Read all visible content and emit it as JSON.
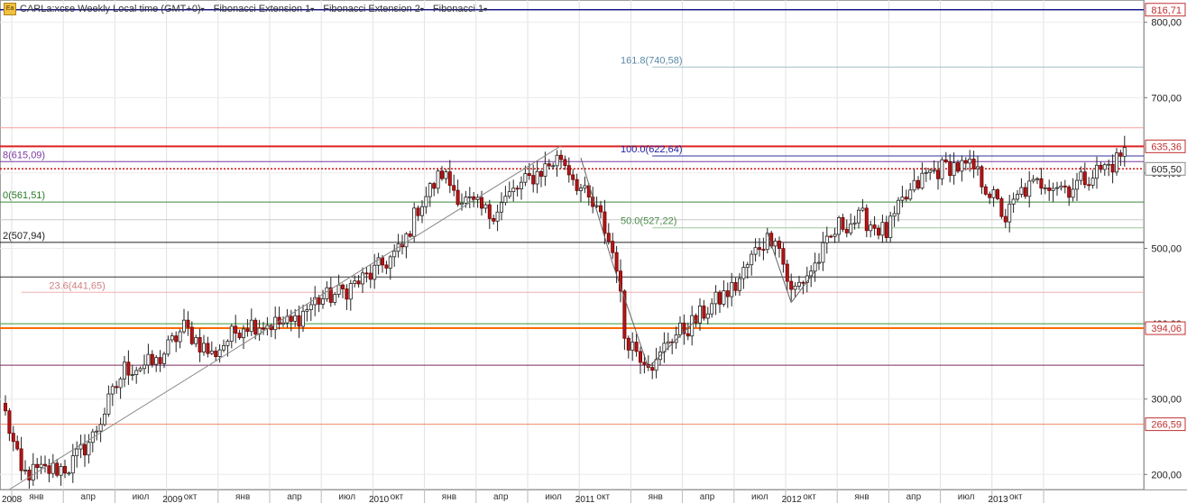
{
  "toolbar": {
    "logo_text": "Ea",
    "items": [
      {
        "label": "CARLa:xcse Weekly Local time (GMT+0)"
      },
      {
        "label": "Fibonacci Extension 1"
      },
      {
        "label": "Fibonacci Extension 2"
      },
      {
        "label": "Fibonacci 1"
      }
    ],
    "caret": "▾"
  },
  "chart_data": {
    "type": "candlestick",
    "ylim": [
      180,
      820
    ],
    "y_ticks": [
      {
        "label": "800,00",
        "value": 800
      },
      {
        "label": "700,00",
        "value": 700
      },
      {
        "label": "600,00",
        "value": 600
      },
      {
        "label": "500,00",
        "value": 500
      },
      {
        "label": "400,00",
        "value": 400
      },
      {
        "label": "300,00",
        "value": 300
      },
      {
        "label": "200,00",
        "value": 200
      }
    ],
    "month_ticks": [
      {
        "label": "окт",
        "bar": 0
      },
      {
        "label": "янв",
        "bar": 13
      },
      {
        "label": "апр",
        "bar": 26
      },
      {
        "label": "июл",
        "bar": 39
      },
      {
        "label": "окт",
        "bar": 52
      },
      {
        "label": "янв",
        "bar": 65
      },
      {
        "label": "апр",
        "bar": 78
      },
      {
        "label": "июл",
        "bar": 91
      },
      {
        "label": "окт",
        "bar": 104
      },
      {
        "label": "янв",
        "bar": 117
      },
      {
        "label": "апр",
        "bar": 130
      },
      {
        "label": "июл",
        "bar": 143
      },
      {
        "label": "окт",
        "bar": 156
      },
      {
        "label": "янв",
        "bar": 169
      },
      {
        "label": "апр",
        "bar": 182
      },
      {
        "label": "июл",
        "bar": 195
      },
      {
        "label": "окт",
        "bar": 208
      },
      {
        "label": "янв",
        "bar": 221
      },
      {
        "label": "апр",
        "bar": 234
      },
      {
        "label": "июл",
        "bar": 247
      },
      {
        "label": "окт",
        "bar": 260
      }
    ],
    "year_ticks": [
      {
        "label": "2008",
        "bar": 0
      },
      {
        "label": "2009",
        "bar": 13
      },
      {
        "label": "2010",
        "bar": 65
      },
      {
        "label": "2011",
        "bar": 117
      },
      {
        "label": "2012",
        "bar": 169
      },
      {
        "label": "2013",
        "bar": 221
      }
    ],
    "price_labels": [
      {
        "label": "816,71",
        "value": 816.71,
        "color": "#c03030",
        "line": "#1a1a8c",
        "width": 1.5
      },
      {
        "label": "635,36",
        "value": 635.36,
        "color": "#c03030",
        "line": "#dd2222",
        "width": 2
      },
      {
        "label": "605,50",
        "value": 605.5,
        "color": "#222222",
        "line": "#cc1111",
        "width": 1.5,
        "dash": true
      },
      {
        "label": "394,06",
        "value": 394.06,
        "color": "#c03030",
        "line": "#ff6a00",
        "width": 2
      },
      {
        "label": "266,59",
        "value": 266.59,
        "color": "#c03030",
        "line": "#ee8866",
        "width": 1
      }
    ],
    "h_lines": [
      {
        "value": 740.58,
        "color": "#a0c0c8",
        "from_bar": 163
      },
      {
        "value": 660,
        "color": "#f2a0a0"
      },
      {
        "value": 622.64,
        "color": "#3030a0",
        "from_bar": 163
      },
      {
        "value": 615.09,
        "color": "#7a3aa0"
      },
      {
        "value": 561.51,
        "color": "#3a8a3a"
      },
      {
        "value": 538,
        "color": "#c8c8c8"
      },
      {
        "value": 527.22,
        "color": "#9ac89a",
        "from_bar": 163
      },
      {
        "value": 507.94,
        "color": "#222222"
      },
      {
        "value": 462,
        "color": "#333333"
      },
      {
        "value": 441.65,
        "color": "#f0b0b0",
        "from_bar": 4
      },
      {
        "value": 400,
        "color": "#3a9a3a"
      },
      {
        "value": 345,
        "color": "#7a2a5a"
      }
    ],
    "fib_labels": [
      {
        "text": "161.8(740,58)",
        "value": 740.58,
        "bar": 155,
        "color": "#5a8aa8"
      },
      {
        "text": "8(615,09)",
        "value": 615.09,
        "bar": 0,
        "color": "#7a3aa0"
      },
      {
        "text": "100.0(622,64)",
        "value": 622.64,
        "bar": 155,
        "color": "#2020a0"
      },
      {
        "text": "0(561,51)",
        "value": 561.51,
        "bar": 0,
        "color": "#2a7a2a"
      },
      {
        "text": "50.0(527,22)",
        "value": 527.22,
        "bar": 155,
        "color": "#4a8a4a"
      },
      {
        "text": "2(507,94)",
        "value": 507.94,
        "bar": 0,
        "color": "#222222"
      },
      {
        "text": "23.6(441,65)",
        "value": 441.65,
        "bar": 11,
        "color": "#d08080"
      }
    ],
    "trend_lines": [
      {
        "from": [
          1,
          180
        ],
        "to": [
          140,
          636
        ],
        "color": "#888888"
      },
      {
        "from": [
          145,
          620
        ],
        "to": [
          153,
          480
        ],
        "color": "#666666"
      },
      {
        "from": [
          153,
          480
        ],
        "to": [
          162,
          342
        ],
        "color": "#666666"
      },
      {
        "from": [
          162,
          342
        ],
        "to": [
          174,
          405
        ],
        "color": "#666666"
      },
      {
        "from": [
          192,
          520
        ],
        "to": [
          198,
          428
        ],
        "color": "#666666"
      },
      {
        "from": [
          198,
          428
        ],
        "to": [
          204,
          470
        ],
        "color": "#666666"
      }
    ],
    "anchors": [
      [
        0,
        280
      ],
      [
        4,
        200
      ],
      [
        10,
        205
      ],
      [
        16,
        210
      ],
      [
        22,
        250
      ],
      [
        30,
        340
      ],
      [
        38,
        348
      ],
      [
        45,
        395
      ],
      [
        52,
        358
      ],
      [
        60,
        400
      ],
      [
        72,
        400
      ],
      [
        78,
        430
      ],
      [
        84,
        440
      ],
      [
        92,
        465
      ],
      [
        100,
        500
      ],
      [
        104,
        555
      ],
      [
        110,
        600
      ],
      [
        115,
        565
      ],
      [
        122,
        545
      ],
      [
        128,
        575
      ],
      [
        134,
        600
      ],
      [
        140,
        622
      ],
      [
        146,
        570
      ],
      [
        150,
        540
      ],
      [
        154,
        480
      ],
      [
        156,
        385
      ],
      [
        160,
        360
      ],
      [
        164,
        345
      ],
      [
        167,
        380
      ],
      [
        172,
        395
      ],
      [
        177,
        420
      ],
      [
        184,
        450
      ],
      [
        190,
        505
      ],
      [
        194,
        520
      ],
      [
        198,
        440
      ],
      [
        204,
        478
      ],
      [
        210,
        530
      ],
      [
        216,
        540
      ],
      [
        222,
        520
      ],
      [
        226,
        560
      ],
      [
        232,
        598
      ],
      [
        238,
        610
      ],
      [
        244,
        605
      ],
      [
        248,
        575
      ],
      [
        252,
        540
      ],
      [
        256,
        575
      ],
      [
        262,
        590
      ],
      [
        268,
        580
      ],
      [
        274,
        600
      ],
      [
        279,
        612
      ],
      [
        282,
        630
      ]
    ],
    "bar_count": 283,
    "bar_spacing": 4.4,
    "first_bar_x": 6
  }
}
